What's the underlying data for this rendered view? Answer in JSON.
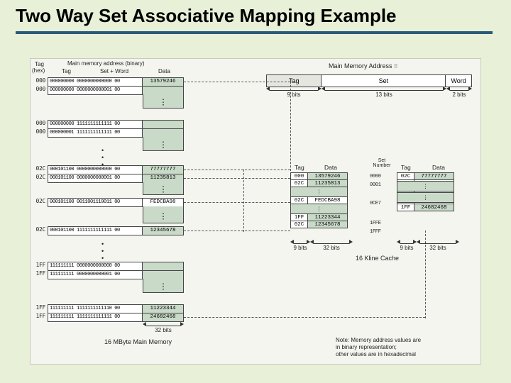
{
  "title": "Two Way Set Associative Mapping Example",
  "labels": {
    "mainMemAddrBinary": "Main memory address (binary)",
    "mainMemAddrEq": "Main Memory Address =",
    "tagHex": "Tag",
    "tagHex2": "(hex)",
    "tagCol": "Tag",
    "setWord": "Set + Word",
    "dataHdr": "Data",
    "mainMemName": "16 MByte Main Memory",
    "cacheName": "16 Kline Cache",
    "setNumber": "Set\nNumber",
    "note1": "Note: Memory address values are",
    "note2": "in binary representation;",
    "note3": "other values are in hexadecimal"
  },
  "addrFields": {
    "tag": "Tag",
    "set": "Set",
    "word": "Word",
    "tagBits": "9 bits",
    "setBits": "13 bits",
    "wordBits": "2 bits"
  },
  "memRows": [
    {
      "hex": "000",
      "bits": "000000000 0000000000000 00",
      "data": "13579246"
    },
    {
      "hex": "000",
      "bits": "000000000 0000000000001 00",
      "data": ""
    },
    {
      "hex": "000",
      "bits": "000000000 1111111111111 00",
      "data": ""
    },
    {
      "hex": "000",
      "bits": "000000001 1111111111111 00",
      "data": ""
    },
    {
      "hex": "02C",
      "bits": "000101100 0000000000000 00",
      "data": "77777777"
    },
    {
      "hex": "02C",
      "bits": "000101100 0000000000001 00",
      "data": "11235813"
    },
    {
      "hex": "02C",
      "bits": "000101100 0011001110011 00",
      "data": "FEDCBA98"
    },
    {
      "hex": "02C",
      "bits": "000101100 1111111111111 00",
      "data": "12345678"
    },
    {
      "hex": "1FF",
      "bits": "111111111 0000000000000 00",
      "data": ""
    },
    {
      "hex": "1FF",
      "bits": "111111111 0000000000001 00",
      "data": ""
    },
    {
      "hex": "1FF",
      "bits": "111111111 1111111111110 00",
      "data": "11223344"
    },
    {
      "hex": "1FF",
      "bits": "111111111 1111111111111 00",
      "data": "24682468"
    }
  ],
  "cacheA": {
    "headers": {
      "tag": "Tag",
      "data": "Data"
    },
    "rows": [
      {
        "tag": "000",
        "data": "13579246"
      },
      {
        "tag": "02C",
        "data": "11235813"
      },
      {
        "tag": "02C",
        "data": "FEDCBA98"
      },
      {
        "tag": "1FF",
        "data": "11223344"
      },
      {
        "tag": "02C",
        "data": "12345678"
      }
    ],
    "widths": {
      "tag": "9 bits",
      "data": "32 bits"
    }
  },
  "cacheB": {
    "headers": {
      "tag": "Tag",
      "data": "Data"
    },
    "rows": [
      {
        "tag": "02C",
        "data": "77777777"
      },
      {
        "tag": "",
        "data": ""
      },
      {
        "tag": "",
        "data": ""
      },
      {
        "tag": "",
        "data": ""
      },
      {
        "tag": "1FF",
        "data": "24682468"
      }
    ],
    "widths": {
      "tag": "9 bits",
      "data": "32 bits"
    }
  },
  "setNumbers": [
    "0000",
    "0001",
    "0CE7",
    "1FFE",
    "1FFF"
  ],
  "bottomWidth": "32 bits"
}
